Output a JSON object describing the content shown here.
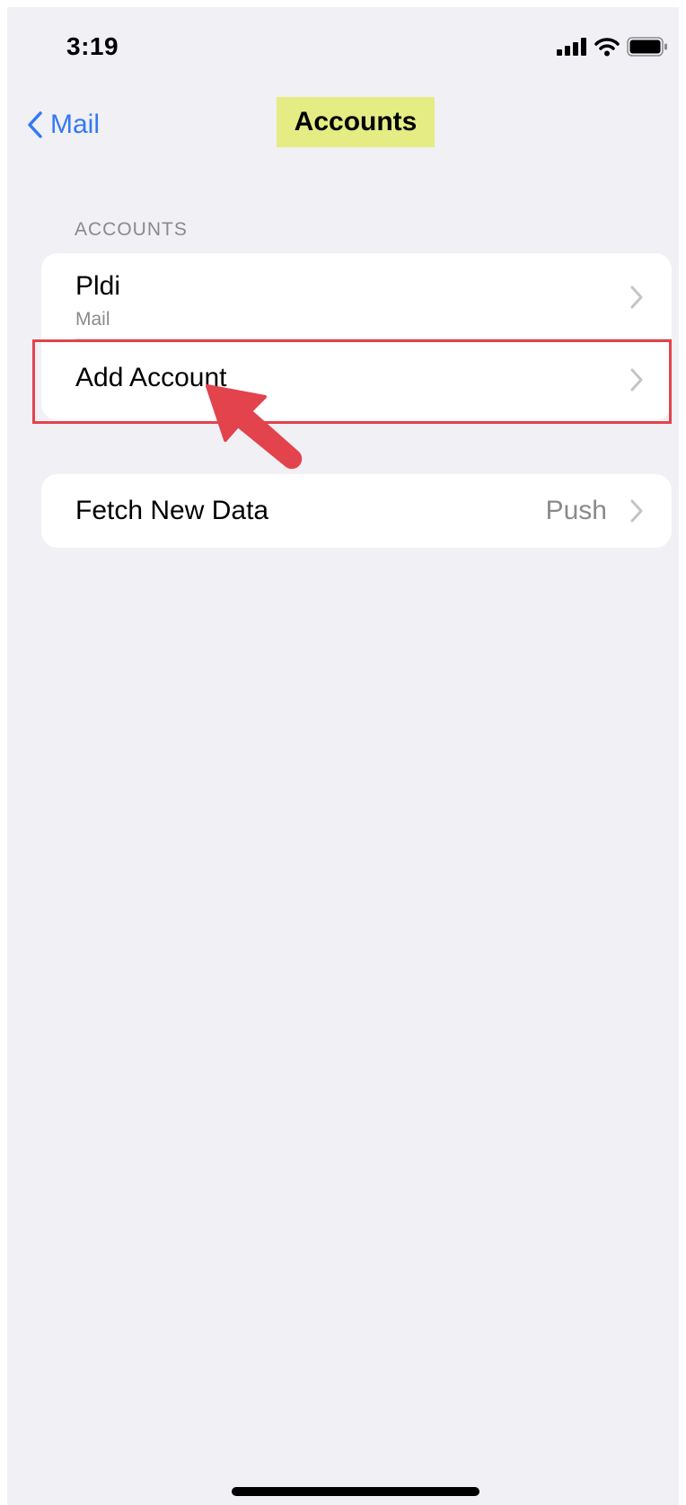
{
  "status_bar": {
    "time": "3:19",
    "icons": [
      "cellular-signal-icon",
      "wifi-icon",
      "battery-icon"
    ]
  },
  "nav": {
    "back_label": "Mail",
    "title": "Accounts"
  },
  "accounts_section": {
    "header": "ACCOUNTS",
    "items": [
      {
        "title": "Pldi",
        "subtitle": "Mail"
      },
      {
        "title": "Add Account"
      }
    ]
  },
  "settings": {
    "fetch_new_data": {
      "label": "Fetch New Data",
      "value": "Push"
    }
  },
  "colors": {
    "accent": "#3478f6",
    "background": "#f0f0f5",
    "title_highlight": "#e5ec83",
    "annotation": "#e2434d"
  }
}
